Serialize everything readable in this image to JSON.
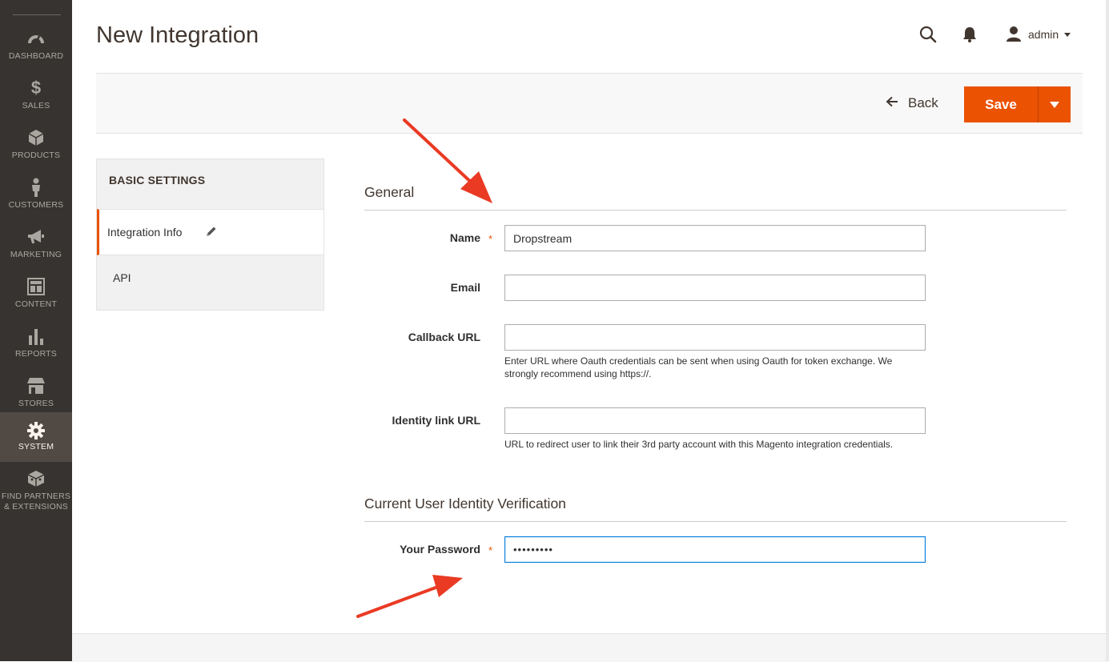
{
  "sidebar": {
    "items": [
      {
        "label": "DASHBOARD",
        "icon": "dashboard-icon"
      },
      {
        "label": "$",
        "icon": "dollar-icon",
        "label2": "SALES"
      },
      {
        "label": "PRODUCTS",
        "icon": "cube-icon"
      },
      {
        "label": "CUSTOMERS",
        "icon": "person-icon"
      },
      {
        "label": "MARKETING",
        "icon": "megaphone-icon"
      },
      {
        "label": "CONTENT",
        "icon": "layout-icon"
      },
      {
        "label": "REPORTS",
        "icon": "bar-chart-icon"
      },
      {
        "label": "STORES",
        "icon": "store-icon"
      },
      {
        "label": "SYSTEM",
        "icon": "gear-icon",
        "active": true
      },
      {
        "label_line1": "FIND PARTNERS",
        "label_line2": "& EXTENSIONS",
        "icon": "extensions-icon"
      }
    ]
  },
  "header": {
    "title": "New Integration",
    "user": "admin"
  },
  "actions": {
    "back_label": "Back",
    "save_label": "Save"
  },
  "tabs": {
    "title": "BASIC SETTINGS",
    "items": [
      {
        "label": "Integration Info",
        "active": true
      },
      {
        "label": "API"
      }
    ]
  },
  "form": {
    "general_title": "General",
    "name_label": "Name",
    "name_value": "Dropstream",
    "email_label": "Email",
    "email_value": "",
    "callback_label": "Callback URL",
    "callback_value": "",
    "callback_note": "Enter URL where Oauth credentials can be sent when using Oauth for token exchange. We strongly recommend using https://.",
    "identity_label": "Identity link URL",
    "identity_value": "",
    "identity_note": "URL to redirect user to link their 3rd party account with this Magento integration credentials.",
    "verification_title": "Current User Identity Verification",
    "password_label": "Your Password",
    "password_value": "•••••••••",
    "required_mark": "*"
  },
  "colors": {
    "accent": "#eb5202",
    "sidebar_bg": "#373330",
    "sidebar_active": "#514943",
    "annotation_arrow": "#ea3a24"
  }
}
